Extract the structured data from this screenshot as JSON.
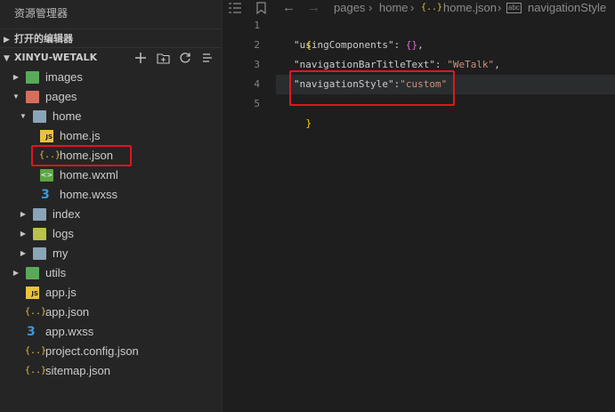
{
  "sidebar": {
    "title": "资源管理器",
    "open_editors": "打开的编辑器",
    "project": "XINYU-WETALK",
    "tree": [
      {
        "label": "images",
        "icon": "folder-images-icon"
      },
      {
        "label": "pages",
        "icon": "folder-pages-icon"
      },
      {
        "label": "home",
        "icon": "folder-open-icon"
      },
      {
        "label": "home.js",
        "icon": "js-file-icon",
        "glyph": "JS"
      },
      {
        "label": "home.json",
        "icon": "json-file-icon",
        "glyph": "{..}"
      },
      {
        "label": "home.wxml",
        "icon": "wxml-file-icon",
        "glyph": "<>"
      },
      {
        "label": "home.wxss",
        "icon": "wxss-file-icon",
        "glyph": "3"
      },
      {
        "label": "index",
        "icon": "folder-icon"
      },
      {
        "label": "logs",
        "icon": "folder-logs-icon"
      },
      {
        "label": "my",
        "icon": "folder-icon"
      },
      {
        "label": "utils",
        "icon": "folder-utils-icon"
      },
      {
        "label": "app.js",
        "icon": "js-file-icon",
        "glyph": "JS"
      },
      {
        "label": "app.json",
        "icon": "json-file-icon",
        "glyph": "{..}"
      },
      {
        "label": "app.wxss",
        "icon": "wxss-file-icon",
        "glyph": "3"
      },
      {
        "label": "project.config.json",
        "icon": "json-file-icon",
        "glyph": "{..}"
      },
      {
        "label": "sitemap.json",
        "icon": "json-file-icon",
        "glyph": "{..}"
      }
    ]
  },
  "breadcrumbs": {
    "items": [
      "pages",
      "home",
      "home.json",
      "navigationStyle"
    ],
    "json_glyph": "{..}",
    "abc_glyph": "abc"
  },
  "editor": {
    "line_numbers": [
      "1",
      "2",
      "3",
      "4",
      "5"
    ],
    "lines": {
      "l1_open": "{",
      "l2_key": "\"usingComponents\"",
      "l2_sep": ": ",
      "l2_val": "{}",
      "l2_end": ",",
      "l3_key": "\"navigationBarTitleText\"",
      "l3_sep": ": ",
      "l3_val": "\"WeTalk\"",
      "l3_end": ",",
      "l4_key": "\"navigationStyle\"",
      "l4_sep": ":",
      "l4_val": "\"custom\"",
      "l5_close": "}"
    }
  },
  "colors": {
    "highlight": "#e0161f",
    "sidebar_bg": "#252526",
    "editor_bg": "#1e1e1e"
  }
}
